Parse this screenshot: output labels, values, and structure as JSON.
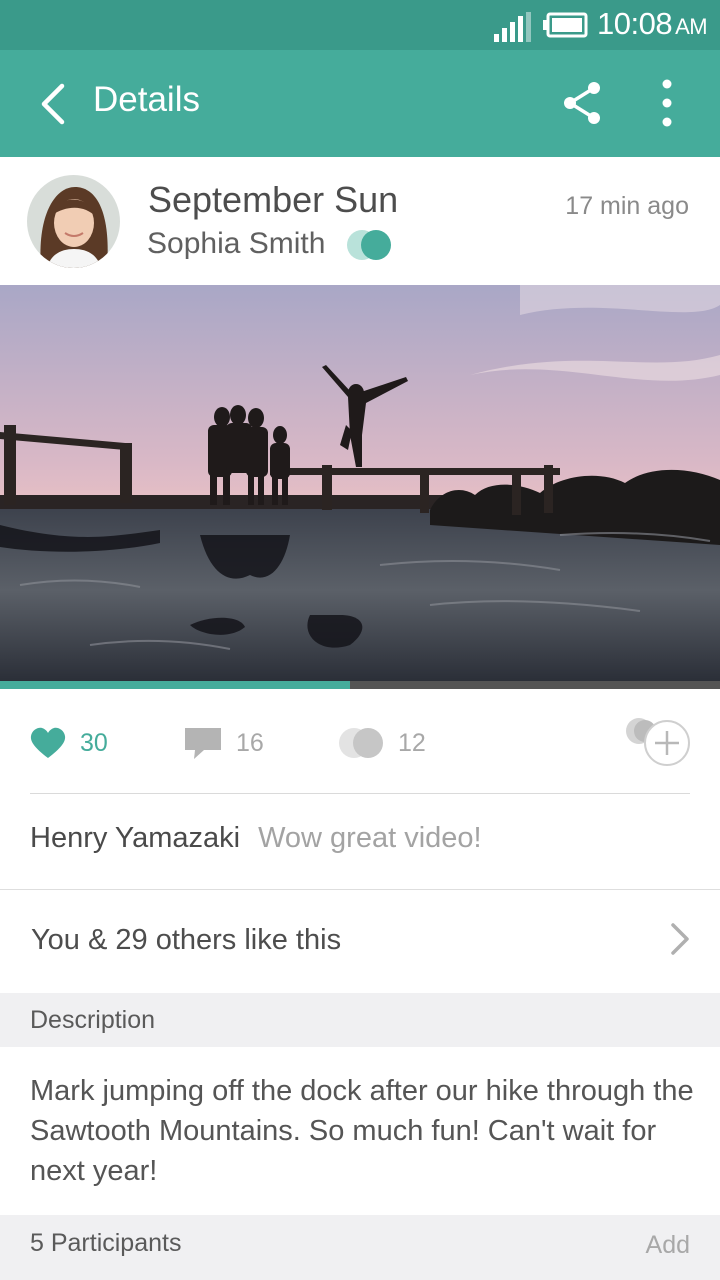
{
  "status_bar": {
    "time": "10:08",
    "ampm": "AM",
    "icons": [
      "signal-icon",
      "battery-icon"
    ]
  },
  "app_bar": {
    "title": "Details",
    "icons": [
      "back-arrow-icon",
      "share-icon",
      "more-vert-icon"
    ]
  },
  "post": {
    "title": "September Sun",
    "author": "Sophia Smith",
    "time_ago": "17 min ago",
    "video_progress_fraction": 0.486
  },
  "stats": {
    "likes": "30",
    "comments": "16",
    "shares": "12"
  },
  "comment": {
    "author": "Henry Yamazaki",
    "text": "Wow great video!"
  },
  "likes_row": {
    "text": "You & 29 others like this"
  },
  "description": {
    "header": "Description",
    "text": "Mark jumping off the dock after our hike through the Sawtooth Mountains. So much fun! Can't wait for next year!"
  },
  "participants": {
    "header": "5 Participants",
    "action": "Add"
  },
  "colors": {
    "accent": "#45ac9b",
    "status_bar": "#3a9a8a",
    "section_bg": "#f0f0f2"
  }
}
